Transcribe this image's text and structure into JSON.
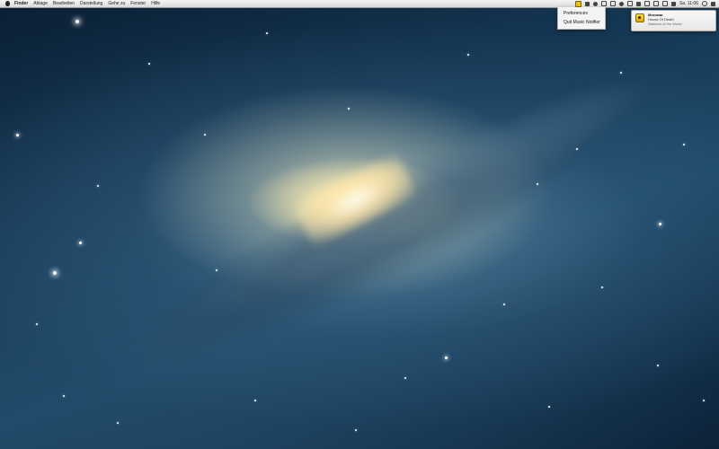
{
  "menubar": {
    "app_name": "Finder",
    "items": [
      "Ablage",
      "Bearbeiten",
      "Darstellung",
      "Gehe zu",
      "Fenster",
      "Hilfe"
    ],
    "clock": "Sa. 11:06"
  },
  "dropdown": {
    "items": [
      "Preferences",
      "Quit Music Notifier"
    ]
  },
  "notification": {
    "title": "Morowar",
    "line2": "House Of Death",
    "line3": "Warriors of the World"
  },
  "colors": {
    "accent": "#f0c000",
    "menubar": "#e6e6e6"
  }
}
